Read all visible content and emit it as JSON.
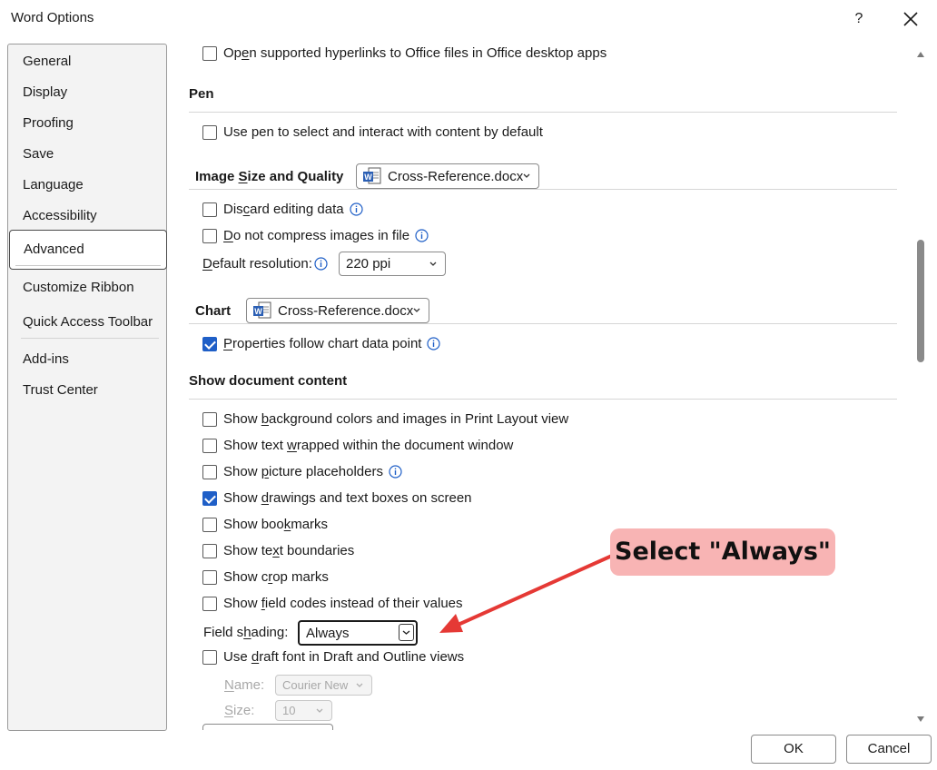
{
  "window": {
    "title": "Word Options",
    "help_label": "?",
    "close_label": "Close"
  },
  "sidebar": {
    "items": [
      {
        "label": "General"
      },
      {
        "label": "Display"
      },
      {
        "label": "Proofing"
      },
      {
        "label": "Save"
      },
      {
        "label": "Language"
      },
      {
        "label": "Accessibility"
      },
      {
        "label": "Advanced",
        "selected": true
      },
      {
        "label": "Customize Ribbon"
      },
      {
        "label": "Quick Access Toolbar"
      },
      {
        "label": "Add-ins"
      },
      {
        "label": "Trust Center"
      }
    ]
  },
  "content": {
    "open_hyperlinks": {
      "pre": "Op",
      "acc": "e",
      "post": "n supported hyperlinks to Office files in Office desktop apps",
      "checked": false
    },
    "pen": {
      "heading": "Pen",
      "use_pen": {
        "label": "Use pen to select and interact with content by default",
        "checked": false
      }
    },
    "image_size": {
      "heading_pre": "Image ",
      "heading_acc": "S",
      "heading_post": "ize and Quality",
      "document": "Cross-Reference.docx",
      "discard": {
        "pre": "Dis",
        "acc": "c",
        "post": "ard editing data",
        "checked": false
      },
      "no_compress": {
        "pre": "",
        "acc": "D",
        "post": "o not compress images in file",
        "checked": false
      },
      "resolution_label_acc": "D",
      "resolution_label_rest": "efault resolution:",
      "resolution_value": "220 ppi"
    },
    "chart": {
      "heading": "Chart",
      "document": "Cross-Reference.docx",
      "properties": {
        "pre": "",
        "acc": "P",
        "post": "roperties follow chart data point",
        "checked": true
      }
    },
    "show_content": {
      "heading": "Show document content",
      "items": [
        {
          "pre": "Show ",
          "acc": "b",
          "post": "ackground colors and images in Print Layout view",
          "checked": false
        },
        {
          "pre": "Show text ",
          "acc": "w",
          "post": "rapped within the document window",
          "checked": false
        },
        {
          "pre": "Show ",
          "acc": "p",
          "post": "icture placeholders",
          "checked": false,
          "info": true
        },
        {
          "pre": "Show ",
          "acc": "d",
          "post": "rawings and text boxes on screen",
          "checked": true
        },
        {
          "pre": "Show boo",
          "acc": "k",
          "post": "marks",
          "checked": false
        },
        {
          "pre": "Show te",
          "acc": "x",
          "post": "t boundaries",
          "checked": false
        },
        {
          "pre": "Show c",
          "acc": "r",
          "post": "op marks",
          "checked": false
        },
        {
          "pre": "Show ",
          "acc": "f",
          "post": "ield codes instead of their values",
          "checked": false
        }
      ],
      "field_shading_pre": "Field s",
      "field_shading_acc": "h",
      "field_shading_post": "ading:",
      "field_shading_value": "Always",
      "draft_font": {
        "pre": "Use ",
        "acc": "d",
        "post": "raft font in Draft and Outline views",
        "checked": false
      },
      "name_label_pre": "",
      "name_label_acc": "N",
      "name_label_post": "ame:",
      "name_value": "Courier New",
      "size_label_pre": "",
      "size_label_acc": "S",
      "size_label_post": "ize:",
      "size_value": "10"
    }
  },
  "annotation": {
    "text": "Select \"Always\"",
    "color": "#f8b4b4",
    "arrow_color": "#e53935"
  },
  "buttons": {
    "ok": "OK",
    "cancel": "Cancel"
  }
}
